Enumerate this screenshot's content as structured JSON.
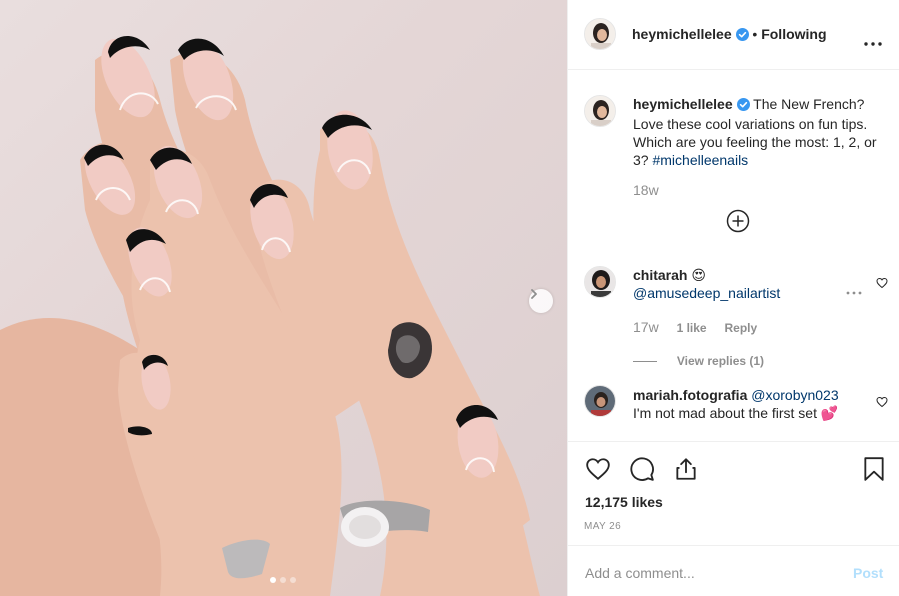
{
  "colors": {
    "text": "#262626",
    "secondary": "#8e8e8e",
    "link": "#00376b",
    "verified": "#3897f0",
    "post_button_disabled": "#b2dffc",
    "nail_black": "#111111",
    "skin": "#e8b9a5"
  },
  "photo": {
    "icons": {
      "next": "chevron-right-icon"
    },
    "carousel": {
      "count": 3,
      "active_index": 0
    }
  },
  "header": {
    "username": "heymichellelee",
    "separator": "•",
    "follow_status": "Following",
    "icons": [
      "verified-badge-icon",
      "more-options-icon"
    ]
  },
  "caption": {
    "username": "heymichellelee",
    "text": "The New French? Love these cool variations on fun tips. Which are you feeling the most: 1, 2, or 3?",
    "hashtag": "#michelleenails",
    "age": "18w"
  },
  "comments": [
    {
      "username": "chitarah",
      "emoji": "😍",
      "mention": "@amusedeep_nailartist",
      "age": "17w",
      "likes": "1 like",
      "reply_label": "Reply",
      "view_replies": "View replies (1)"
    },
    {
      "username": "mariah.fotografia",
      "mention": "@xorobyn023",
      "text": "I'm not mad about the first set",
      "emoji": "💕"
    }
  ],
  "actions": {
    "icons": [
      "heart-icon",
      "comment-icon",
      "share-icon",
      "bookmark-icon"
    ],
    "likes": "12,175 likes",
    "date": "MAY 26"
  },
  "add_comment": {
    "placeholder": "Add a comment...",
    "post_label": "Post"
  }
}
